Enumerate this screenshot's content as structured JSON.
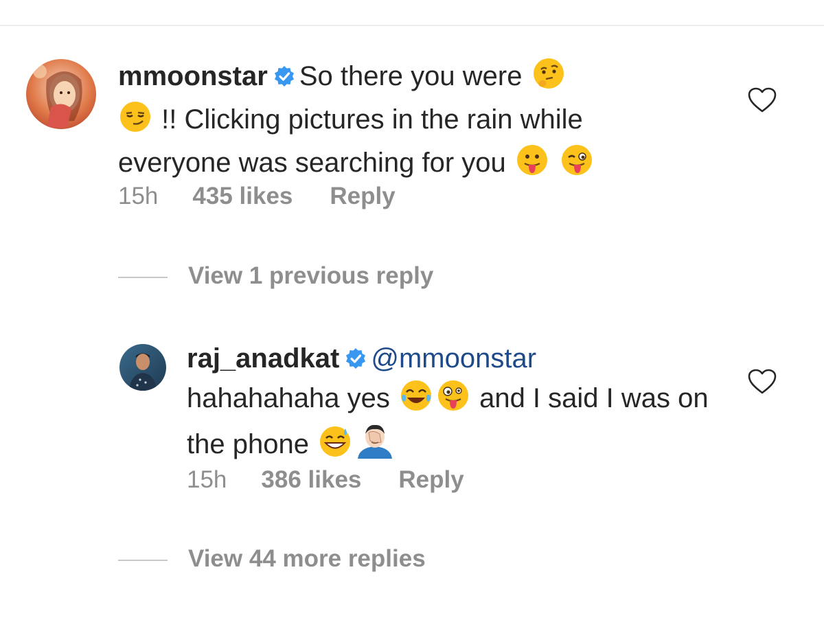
{
  "colors": {
    "text": "#262626",
    "muted": "#8e8e8e",
    "mention": "#1f4a8a",
    "verified": "#3897f0"
  },
  "comment": {
    "username": "mmoonstar",
    "avatar_icon": "profile-photo-icon",
    "text_part1": "So there you were",
    "text_part2": "!! Clicking pictures in the rain while everyone was searching for you",
    "emojis": [
      "thinking-face-icon",
      "smirking-face-icon",
      "tongue-out-face-icon",
      "winking-tongue-face-icon"
    ],
    "time": "15h",
    "likes": "435 likes",
    "reply": "Reply"
  },
  "previous_replies": {
    "label": "View 1 previous reply"
  },
  "reply": {
    "username": "raj_anadkat",
    "avatar_icon": "profile-photo-icon",
    "mention": "@mmoonstar",
    "text_part1": "hahahahaha yes",
    "text_part2": "and I said I was on the phone",
    "emojis": [
      "tears-of-joy-face-icon",
      "zany-face-icon",
      "sweat-smile-face-icon",
      "facepalm-person-icon"
    ],
    "time": "15h",
    "likes": "386 likes",
    "reply": "Reply"
  },
  "more_replies": {
    "label": "View 44 more replies"
  }
}
